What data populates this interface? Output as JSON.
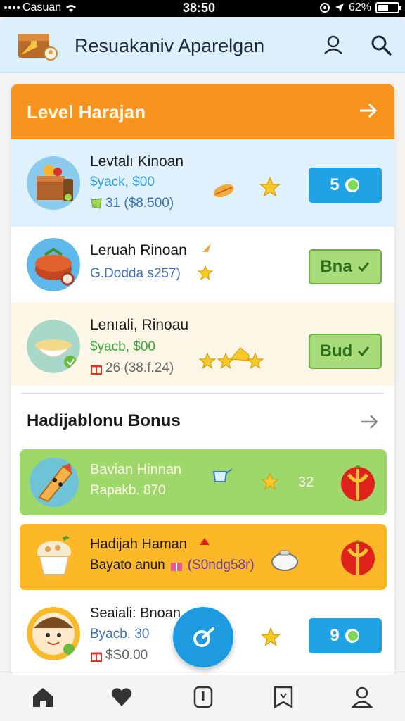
{
  "status_bar": {
    "carrier": "Casuan",
    "time": "38:50",
    "battery": "62%"
  },
  "header": {
    "title": "Resuakaniv Aparelgan",
    "icons": [
      "treasure-chest-logo",
      "user-icon",
      "search-icon"
    ]
  },
  "level_section": {
    "title": "Level Harajan",
    "items": [
      {
        "name": "Levtalı Kinoan",
        "price": "$yack, $00",
        "meta": "31 ($8.500)",
        "button": "5",
        "button_style": "blue",
        "thumb": "crate-icon"
      },
      {
        "name": "Leruah Rinoan",
        "price": "",
        "meta": "G.Dodda s257)",
        "button": "Bna",
        "button_style": "green",
        "thumb": "cake-icon"
      },
      {
        "name": "Lenıali, Rinoau",
        "price": "$yacb, $00",
        "meta": "26 (38.f.24)",
        "button": "Bud",
        "button_style": "green",
        "thumb": "soup-bowl-icon"
      }
    ]
  },
  "bonus_section": {
    "title": "Hadijablonu Bonus",
    "items": [
      {
        "name": "Bavian Hinnan",
        "sub": "Rapakb. 870",
        "value": "32",
        "bg": "#9fd86a",
        "thumb": "taco-character-icon"
      },
      {
        "name": "Hadijah Haman",
        "sub": "Bayato anun",
        "sub_extra": "(S0ndg58r)",
        "bg": "#fdb827",
        "thumb": "cupcake-icon"
      },
      {
        "name": "Seaiali: Bnoan",
        "sub": "Byacb. 30",
        "meta": "$S0.00",
        "button": "9",
        "button_style": "blue",
        "thumb": "character-face-icon"
      }
    ]
  },
  "nav": [
    "home-icon",
    "heart-icon",
    "info-icon",
    "bookmark-icon",
    "profile-icon"
  ]
}
